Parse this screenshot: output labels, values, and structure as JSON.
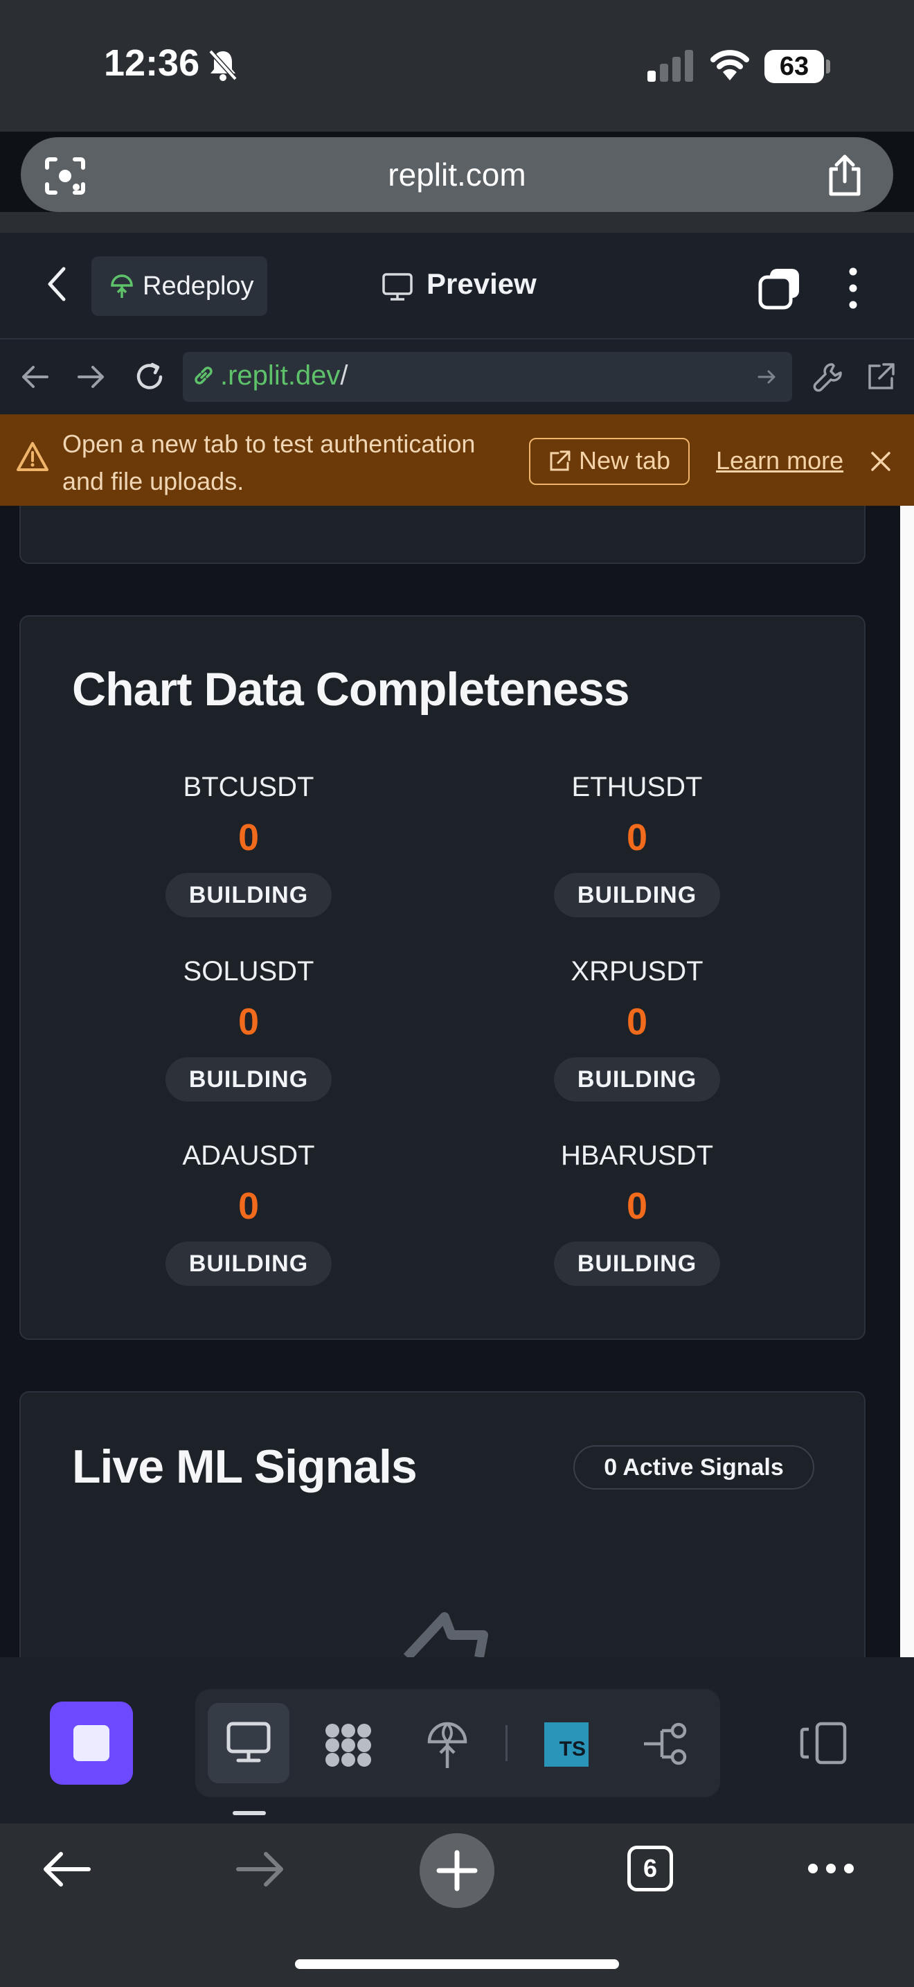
{
  "status_bar": {
    "time": "12:36",
    "battery": "63"
  },
  "browser": {
    "url": "replit.com",
    "tab_count": "6"
  },
  "replit_header": {
    "redeploy_label": "Redeploy",
    "preview_label": "Preview"
  },
  "address": {
    "domain": ".replit.dev",
    "path": "/"
  },
  "banner": {
    "message": "Open a new tab to test authentication and file uploads.",
    "new_tab_label": "New tab",
    "learn_more_label": "Learn more"
  },
  "chart_completeness": {
    "title": "Chart Data Completeness",
    "items": [
      {
        "symbol": "BTCUSDT",
        "count": "0",
        "status": "BUILDING"
      },
      {
        "symbol": "ETHUSDT",
        "count": "0",
        "status": "BUILDING"
      },
      {
        "symbol": "SOLUSDT",
        "count": "0",
        "status": "BUILDING"
      },
      {
        "symbol": "XRPUSDT",
        "count": "0",
        "status": "BUILDING"
      },
      {
        "symbol": "ADAUSDT",
        "count": "0",
        "status": "BUILDING"
      },
      {
        "symbol": "HBARUSDT",
        "count": "0",
        "status": "BUILDING"
      }
    ]
  },
  "live_signals": {
    "title": "Live ML Signals",
    "badge": "0 Active Signals"
  },
  "colors": {
    "accent_orange": "#f26a1b",
    "banner_bg": "#6b3a08",
    "stop_button": "#6d4aff",
    "link_green": "#5ec26a"
  }
}
